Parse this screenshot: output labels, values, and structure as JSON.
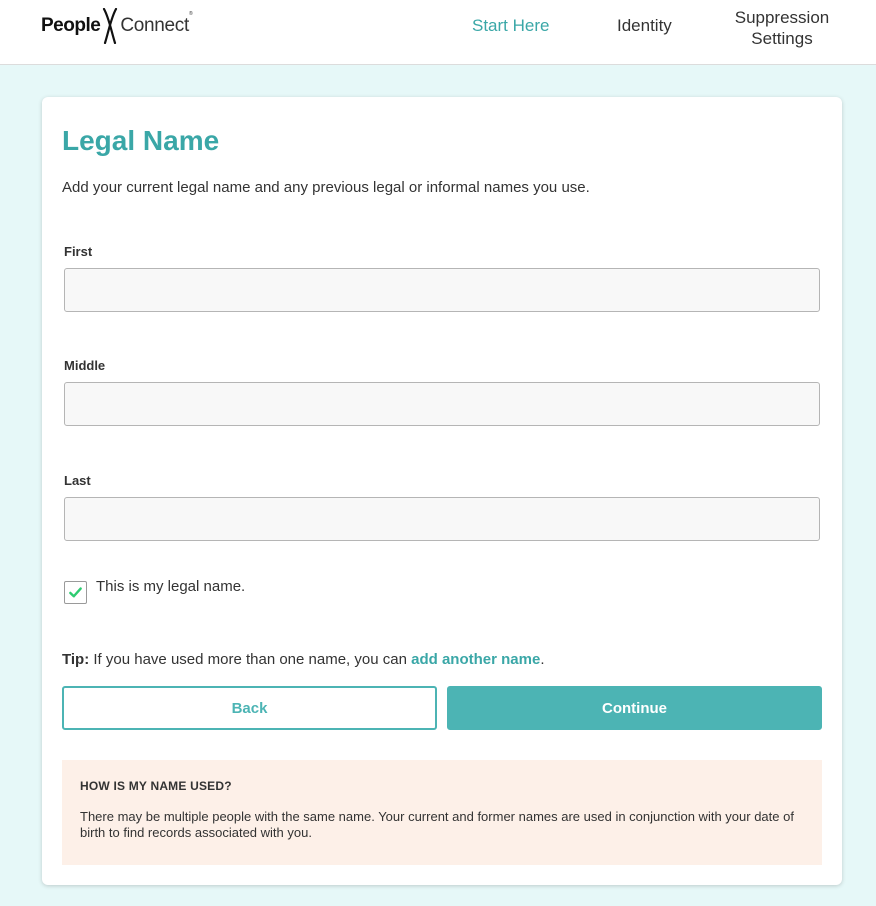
{
  "header": {
    "logo": {
      "people": "People",
      "connect": "Connect",
      "reg": "®"
    },
    "nav": {
      "start_here": "Start Here",
      "identity": "Identity",
      "suppression_line1": "Suppression",
      "suppression_line2": "Settings"
    }
  },
  "form": {
    "title": "Legal Name",
    "subtitle": "Add your current legal name and any previous legal or informal names you use.",
    "fields": {
      "first": {
        "label": "First",
        "value": "",
        "placeholder": ""
      },
      "middle": {
        "label": "Middle",
        "value": "",
        "placeholder": ""
      },
      "last": {
        "label": "Last",
        "value": "",
        "placeholder": ""
      }
    },
    "legal_checkbox": {
      "label": "This is my legal name.",
      "checked": true
    },
    "tip": {
      "prefix": "Tip:",
      "text": "If you have used more than one name, you can",
      "link": "add another name",
      "suffix": "."
    },
    "buttons": {
      "back": "Back",
      "continue": "Continue"
    },
    "info": {
      "title": "HOW IS MY NAME USED?",
      "text": "There may be multiple people with the same name. Your current and former names are used in conjunction with your date of birth to find records associated with you."
    }
  },
  "colors": {
    "accent": "#3aa7a7",
    "button": "#4cb4b4",
    "page_bg": "#e6f8f8",
    "info_bg": "#fdf0e8",
    "check": "#2ecc71"
  },
  "icons": {
    "logo_mark": "x-figure-icon",
    "checkbox": "checkmark-icon"
  }
}
